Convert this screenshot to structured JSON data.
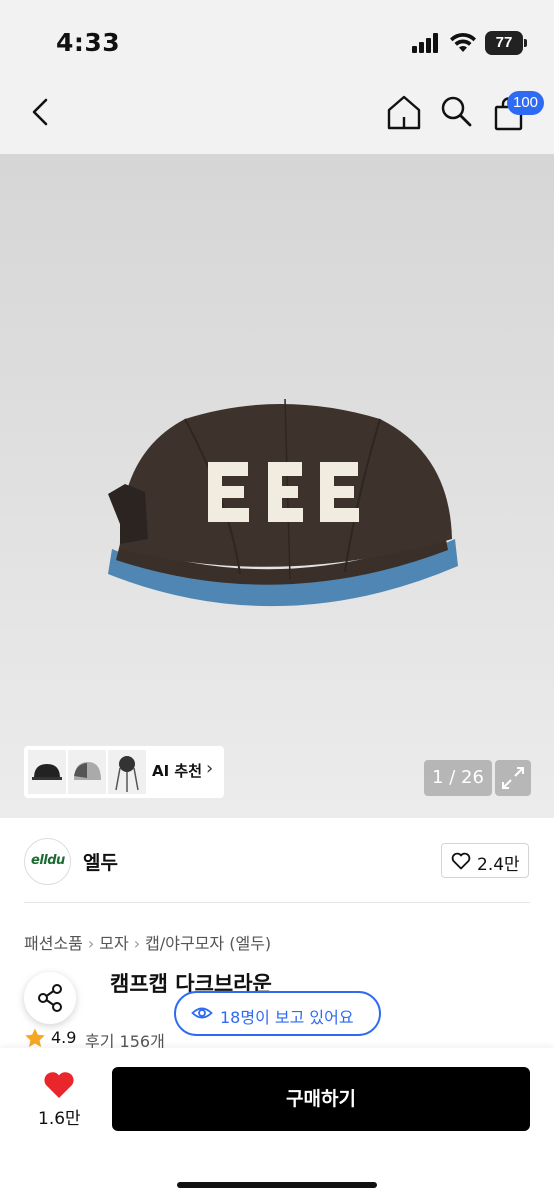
{
  "status_bar": {
    "time": "4:33",
    "battery": "77"
  },
  "nav": {
    "cart_count": "100"
  },
  "gallery": {
    "ai_label": "AI 추천",
    "page_counter": "1 / 26"
  },
  "brand": {
    "name": "엘두",
    "logo_text": "elldu",
    "likes": "2.4만"
  },
  "breadcrumb": [
    "패션소품",
    "모자",
    "캡/야구모자 (엘두)"
  ],
  "product": {
    "title": "캠프캡 다크브라운",
    "rating": "4.9",
    "reviews": "후기 156개",
    "viewers": "18명이 보고 있어요"
  },
  "bottom": {
    "wish_count": "1.6만",
    "buy_label": "구매하기"
  },
  "colors": {
    "accent": "#2f6bf2",
    "wish": "#e8262c",
    "star": "#f5a623"
  }
}
